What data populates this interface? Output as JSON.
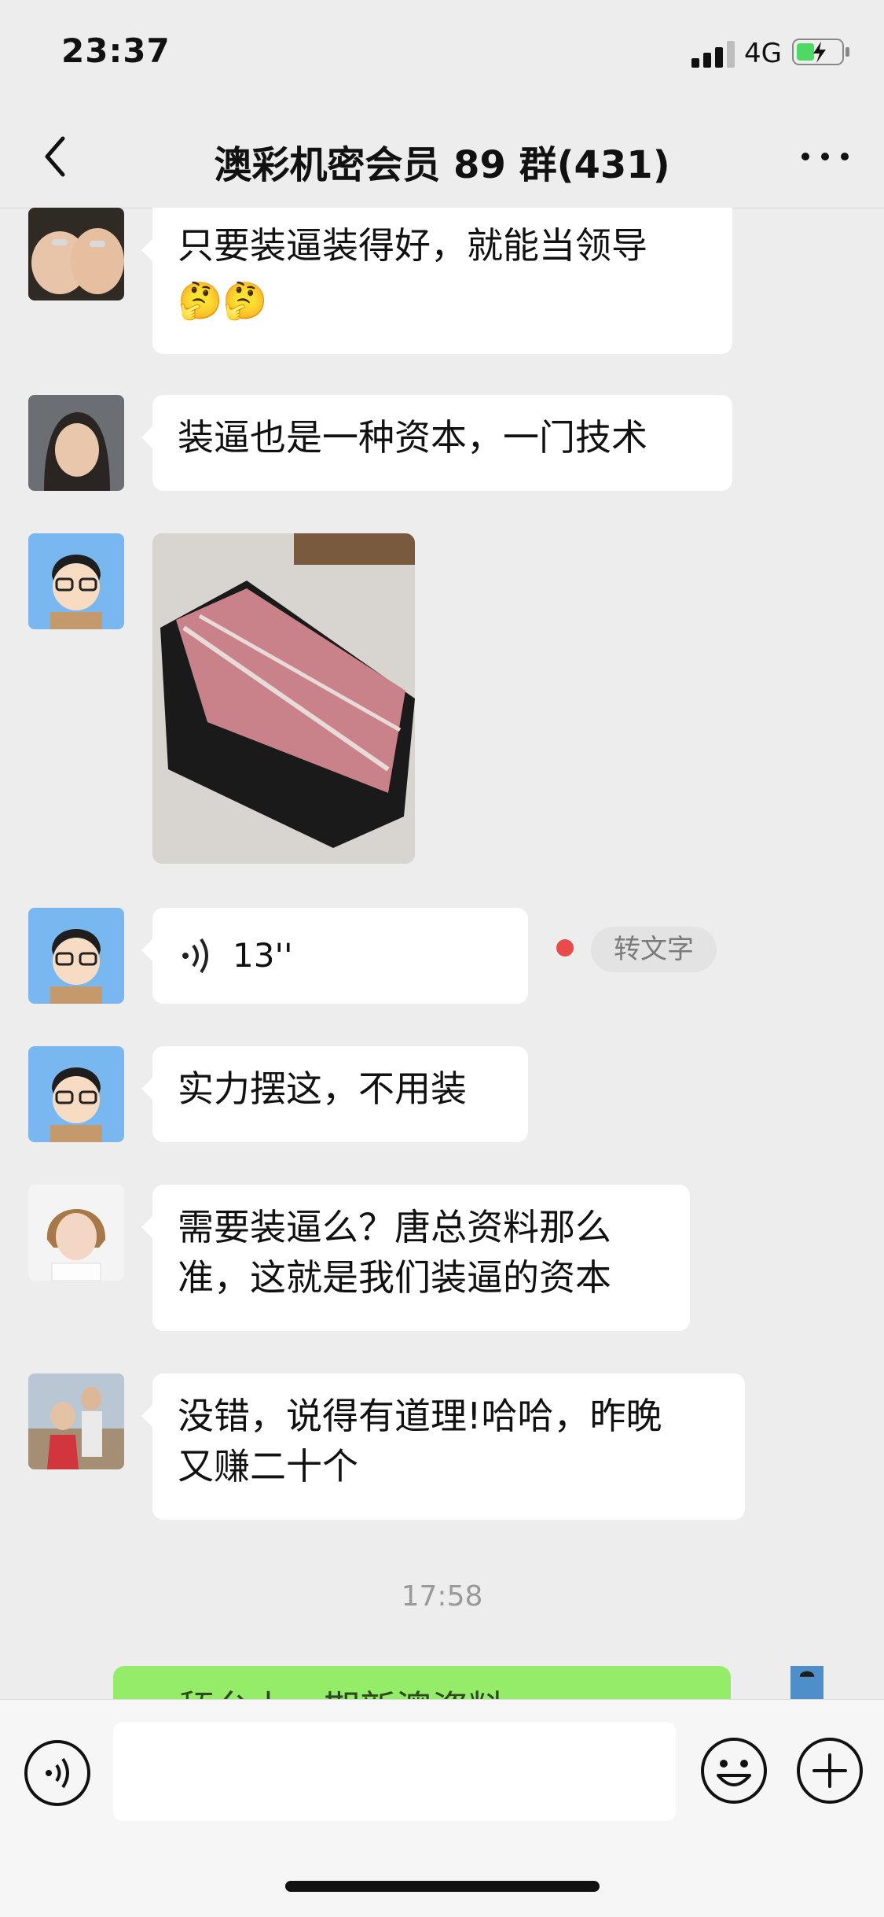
{
  "status": {
    "time": "23:37",
    "network": "4G"
  },
  "header": {
    "title": "澳彩机密会员 89 群(431)"
  },
  "messages": [
    {
      "text": "只要装逼装得好，就能当领导",
      "emoji": "🤔🤔"
    },
    {
      "text": "装逼也是一种资本，一门技术"
    },
    {
      "type": "image",
      "desc": "photo-money"
    },
    {
      "type": "voice",
      "duration": "13''",
      "convert_label": "转文字"
    },
    {
      "text": "实力摆这，不用装"
    },
    {
      "line1": "需要装逼么？唐总资料那么",
      "line2": "准，这就是我们装逼的资本"
    },
    {
      "line1": "没错，说得有道理!哈哈，昨晚",
      "line2": "又赚二十个"
    }
  ],
  "time_divider": "17:58",
  "sent_preview": "舔台上一期新澳资料",
  "input": {
    "placeholder": ""
  }
}
